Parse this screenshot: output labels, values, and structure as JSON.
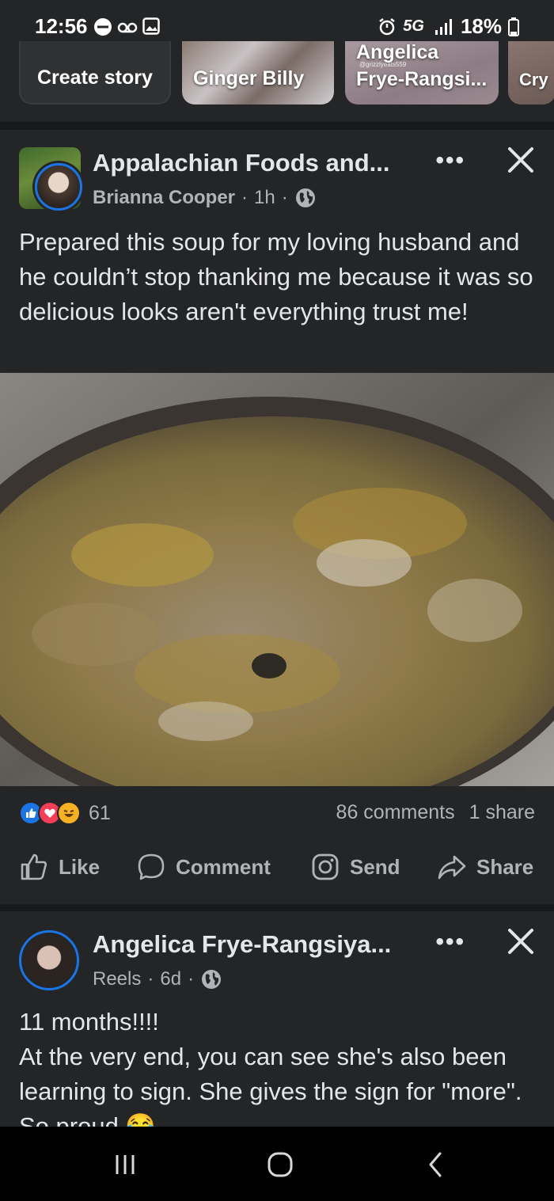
{
  "status_bar": {
    "time": "12:56",
    "network": "5G",
    "battery": "18%"
  },
  "stories": {
    "create_label": "Create story",
    "items": [
      {
        "name": "Ginger Billy"
      },
      {
        "name_line1": "Angelica",
        "name_line2": "Frye-Rangsi...",
        "sub": "@grizzlyeats559"
      },
      {
        "name": "Cry"
      }
    ]
  },
  "post1": {
    "group": "Appalachian Foods and...",
    "author": "Brianna Cooper",
    "time": "1h",
    "separator": "·",
    "text": "Prepared this soup for my loving husband and he couldn’t stop thanking me because it was so delicious looks aren't everything trust me!",
    "reaction_count": "61",
    "comments": "86 comments",
    "shares": "1 share",
    "more_label": "•••"
  },
  "actions": {
    "like": "Like",
    "comment": "Comment",
    "send": "Send",
    "share": "Share"
  },
  "post2": {
    "author": "Angelica Frye-Rangsiya...",
    "source": "Reels",
    "time": "6d",
    "separator": "·",
    "text": "11 months!!!!\nAt the very end, you can see she's also been learning to sign. She gives the sign for \"more\". So proud 😂",
    "more_label": "•••"
  },
  "colors": {
    "background": "#242526",
    "accent": "#1b74e4",
    "text_primary": "#e4e6eb",
    "text_secondary": "#b0b3b8"
  }
}
